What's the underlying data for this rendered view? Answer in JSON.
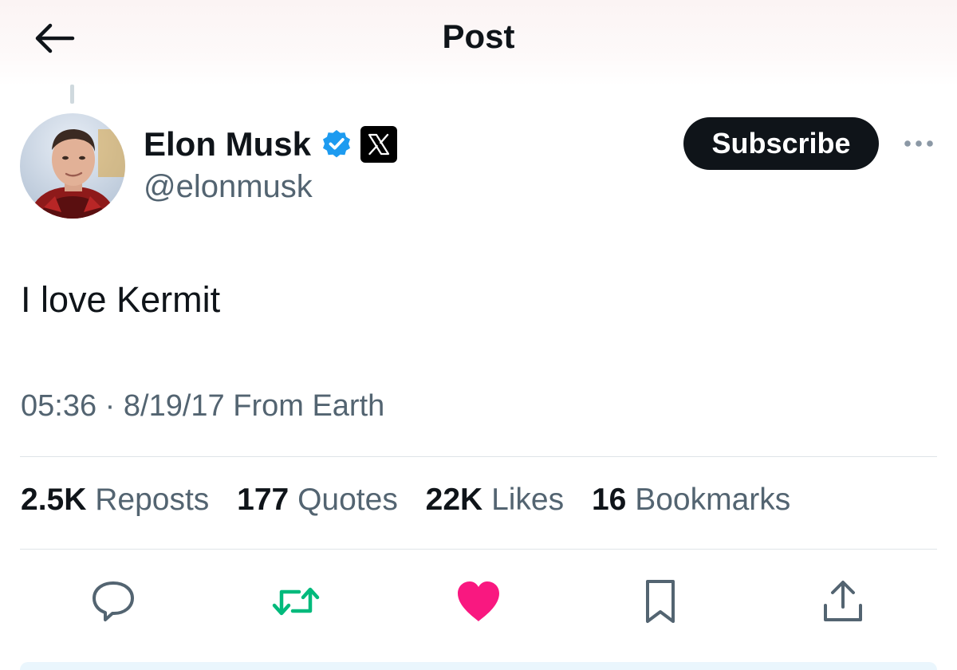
{
  "header": {
    "title": "Post",
    "back_icon": "arrow-left-icon"
  },
  "author": {
    "name": "Elon Musk",
    "handle": "@elonmusk",
    "verified_icon": "verified-badge-icon",
    "affiliate_icon": "x-logo-icon",
    "subscribe_label": "Subscribe",
    "more_icon": "more-horizontal-icon"
  },
  "post": {
    "text": "I love Kermit",
    "time": "05:36",
    "separator": "·",
    "date": "8/19/17",
    "source": "From Earth"
  },
  "stats": [
    {
      "value": "2.5K",
      "label": "Reposts"
    },
    {
      "value": "177",
      "label": "Quotes"
    },
    {
      "value": "22K",
      "label": "Likes"
    },
    {
      "value": "16",
      "label": "Bookmarks"
    }
  ],
  "actions": [
    {
      "name": "reply",
      "icon": "reply-bubble-icon"
    },
    {
      "name": "repost",
      "icon": "repost-icon"
    },
    {
      "name": "like",
      "icon": "heart-icon"
    },
    {
      "name": "bookmark",
      "icon": "bookmark-icon"
    },
    {
      "name": "share",
      "icon": "share-icon"
    }
  ],
  "colors": {
    "text_primary": "#0f1419",
    "text_secondary": "#536471",
    "verified_blue": "#1d9bf0",
    "repost_green": "#00ba7c",
    "like_pink": "#f91880",
    "subscribe_bg": "#0f1419"
  }
}
